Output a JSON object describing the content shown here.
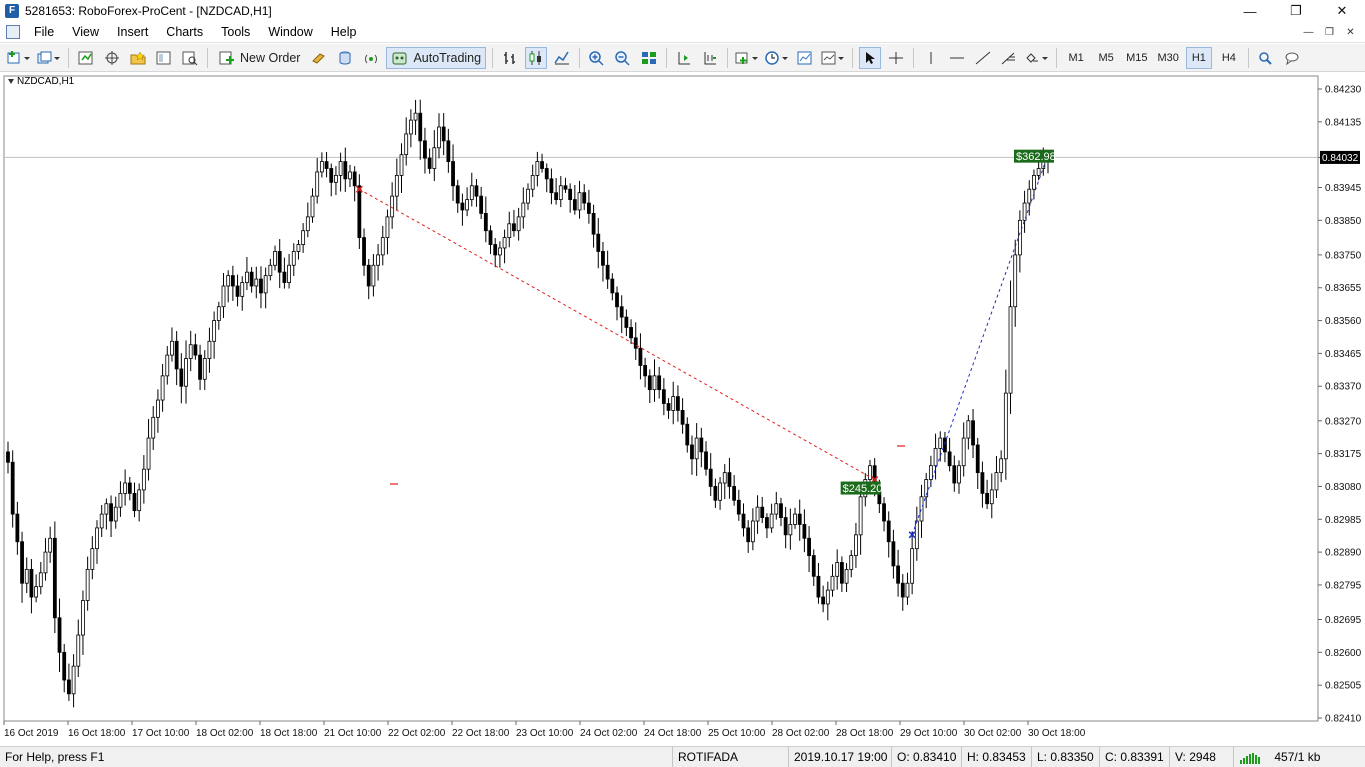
{
  "window": {
    "title": "5281653: RoboForex-ProCent - [NZDCAD,H1]",
    "app_icon_glyph": "F",
    "controls": [
      "—",
      "❐",
      "✕"
    ]
  },
  "menu": {
    "items": [
      "File",
      "View",
      "Insert",
      "Charts",
      "Tools",
      "Window",
      "Help"
    ],
    "mdi_controls": [
      "—",
      "❐",
      "✕"
    ]
  },
  "toolbar": {
    "new_order_label": "New Order",
    "autotrading_label": "AutoTrading",
    "timeframes": [
      "M1",
      "M5",
      "M15",
      "M30",
      "H1",
      "H4"
    ],
    "active_timeframe": "H1"
  },
  "chart": {
    "label": "NZDCAD,H1",
    "colors": {
      "candle": "#000000",
      "grid_line": "#c0c0c0",
      "trade_line_loss": "#e02020",
      "trade_line_win": "#1a2fd0",
      "profit_box": "#1c6b1c",
      "current_price_box": "#000000"
    },
    "current_price": "0.84032",
    "price_labels": [
      "0.84230",
      "0.84135",
      "0.84032",
      "0.83945",
      "0.83850",
      "0.83750",
      "0.83655",
      "0.83560",
      "0.83465",
      "0.83370",
      "0.83270",
      "0.83175",
      "0.83080",
      "0.82985",
      "0.82890",
      "0.82795",
      "0.82695",
      "0.82600",
      "0.82505",
      "0.82410"
    ],
    "time_labels": [
      "16 Oct 2019",
      "16 Oct 18:00",
      "17 Oct 10:00",
      "18 Oct 02:00",
      "18 Oct 18:00",
      "21 Oct 10:00",
      "22 Oct 02:00",
      "22 Oct 18:00",
      "23 Oct 10:00",
      "24 Oct 02:00",
      "24 Oct 18:00",
      "25 Oct 10:00",
      "28 Oct 02:00",
      "28 Oct 18:00",
      "29 Oct 10:00",
      "30 Oct 02:00",
      "30 Oct 18:00"
    ],
    "trades": [
      {
        "profit": "$245.20",
        "open_price": 0.8394,
        "close_price": 0.831
      },
      {
        "profit": "$362.98",
        "open_price": 0.8294,
        "close_price": 0.8404
      }
    ],
    "price_closes": [
      0.8315,
      0.83,
      0.8292,
      0.828,
      0.8284,
      0.8276,
      0.8279,
      0.8283,
      0.8289,
      0.8293,
      0.827,
      0.826,
      0.8252,
      0.8248,
      0.8256,
      0.8265,
      0.8275,
      0.8284,
      0.829,
      0.8296,
      0.83,
      0.8303,
      0.8298,
      0.8302,
      0.8306,
      0.8309,
      0.8306,
      0.8301,
      0.8307,
      0.8313,
      0.8322,
      0.8328,
      0.8333,
      0.834,
      0.8346,
      0.835,
      0.8342,
      0.8337,
      0.8345,
      0.8349,
      0.8346,
      0.8339,
      0.8345,
      0.835,
      0.8356,
      0.836,
      0.8366,
      0.8369,
      0.8366,
      0.8363,
      0.8367,
      0.837,
      0.8366,
      0.8368,
      0.8364,
      0.8369,
      0.8372,
      0.8376,
      0.837,
      0.8367,
      0.8372,
      0.8376,
      0.8378,
      0.8382,
      0.8386,
      0.8392,
      0.8399,
      0.8402,
      0.84,
      0.8396,
      0.8398,
      0.8402,
      0.8397,
      0.8399,
      0.8395,
      0.838,
      0.8372,
      0.8366,
      0.8372,
      0.8375,
      0.838,
      0.8386,
      0.8392,
      0.8398,
      0.8404,
      0.841,
      0.8414,
      0.8416,
      0.8408,
      0.8403,
      0.84,
      0.8406,
      0.8412,
      0.8408,
      0.8402,
      0.8395,
      0.839,
      0.8388,
      0.8391,
      0.8395,
      0.8392,
      0.8387,
      0.8382,
      0.8378,
      0.8375,
      0.8377,
      0.838,
      0.8384,
      0.8382,
      0.8386,
      0.839,
      0.8394,
      0.8398,
      0.8402,
      0.84,
      0.8397,
      0.8393,
      0.8391,
      0.8395,
      0.8394,
      0.8391,
      0.8388,
      0.8393,
      0.839,
      0.8387,
      0.8381,
      0.8376,
      0.8372,
      0.8368,
      0.8364,
      0.836,
      0.8357,
      0.8354,
      0.8351,
      0.8348,
      0.8343,
      0.834,
      0.8336,
      0.834,
      0.8336,
      0.8332,
      0.833,
      0.8334,
      0.833,
      0.8326,
      0.832,
      0.8316,
      0.8322,
      0.8318,
      0.8313,
      0.8308,
      0.8304,
      0.8309,
      0.8312,
      0.8308,
      0.8304,
      0.83,
      0.8296,
      0.8292,
      0.8298,
      0.8302,
      0.8299,
      0.8296,
      0.83,
      0.8303,
      0.8299,
      0.8294,
      0.8297,
      0.83,
      0.8297,
      0.8293,
      0.8288,
      0.8282,
      0.8276,
      0.8274,
      0.8278,
      0.8282,
      0.8286,
      0.828,
      0.8284,
      0.8288,
      0.8294,
      0.8305,
      0.831,
      0.8314,
      0.8308,
      0.8303,
      0.8298,
      0.8292,
      0.8285,
      0.828,
      0.8276,
      0.828,
      0.829,
      0.8298,
      0.8305,
      0.831,
      0.8314,
      0.8319,
      0.8322,
      0.8318,
      0.8314,
      0.8309,
      0.8314,
      0.8322,
      0.8327,
      0.832,
      0.8312,
      0.8306,
      0.8303,
      0.8307,
      0.8312,
      0.8316,
      0.8335,
      0.836,
      0.8375,
      0.8385,
      0.839,
      0.8394,
      0.8398,
      0.84,
      0.8403,
      0.8404
    ]
  },
  "status": {
    "help": "For Help, press F1",
    "profile": "ROTIFADA",
    "datetime": "2019.10.17 19:00",
    "open": "O: 0.83410",
    "high": "H: 0.83453",
    "low": "L: 0.83350",
    "close": "C: 0.83391",
    "volume": "V: 2948",
    "traffic": "457/1 kb"
  }
}
